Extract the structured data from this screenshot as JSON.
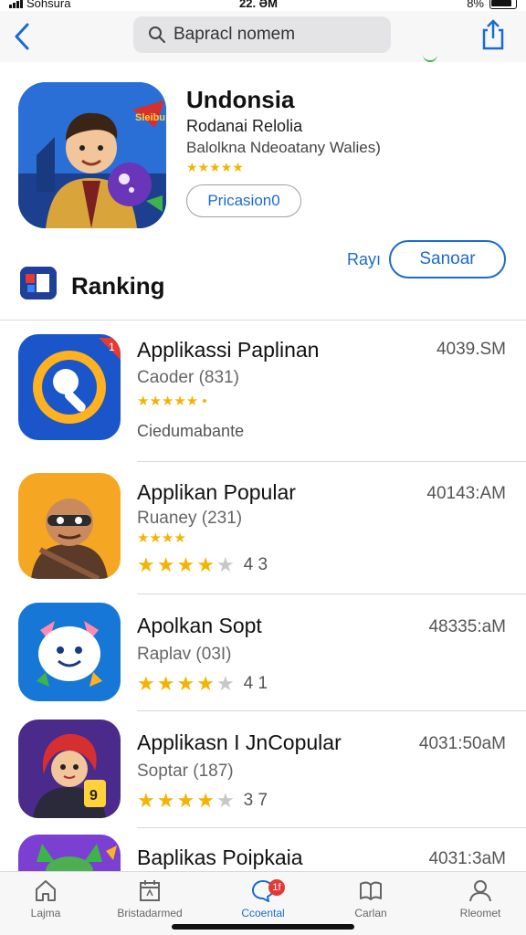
{
  "status": {
    "carrier": "Sohsura",
    "time": "22. ƏM",
    "battery": "8%"
  },
  "nav": {
    "search_text": "Bapracl nomem"
  },
  "hero": {
    "title": "Undonsia",
    "subtitle": "Rodanai Relolia",
    "developer": "Balolkna Ndeoatany Walies)",
    "stars": "★★★★★",
    "button_label": "Pricasion0",
    "badge_text": "Sleibu"
  },
  "section": {
    "see_label": "Rayı",
    "button_label": "Sanoar",
    "title": "Ranking"
  },
  "apps": [
    {
      "name": "Applikassi Paplinan",
      "size": "4039.SM",
      "meta": "Caoder (831)",
      "stars_text": "★★★★★ •",
      "extra": "Ciedumabante",
      "badge": "1"
    },
    {
      "name": "Applikan Popular",
      "size": "40143:AM",
      "meta": "Ruaney (231)",
      "stars_text": "★★★★",
      "rating": "4 3",
      "rating_value": 4.3
    },
    {
      "name": "Apolkan Sopt",
      "size": "48335:aM",
      "meta": "Raplav (03I)",
      "rating": "4 1",
      "rating_value": 4.1,
      "icon_badge": ""
    },
    {
      "name": "Applikasn I JnCopular",
      "size": "4031:50aM",
      "meta": "Soptar (187)",
      "rating": "3 7",
      "rating_value": 3.7,
      "icon_number": "9"
    },
    {
      "name": "Baplikas Poipkaia",
      "size": "4031:3aM"
    }
  ],
  "tabs": [
    {
      "label": "Lajma",
      "icon": "home-icon"
    },
    {
      "label": "Bristadarmed",
      "icon": "calendar-icon"
    },
    {
      "label": "Ccoental",
      "icon": "chat-icon",
      "badge": "1f",
      "active": true
    },
    {
      "label": "Carlan",
      "icon": "book-icon"
    },
    {
      "label": "Rleomet",
      "icon": "person-icon"
    }
  ],
  "colors": {
    "accent": "#1a6ad3",
    "star": "#f5b301",
    "badge": "#e53935"
  }
}
